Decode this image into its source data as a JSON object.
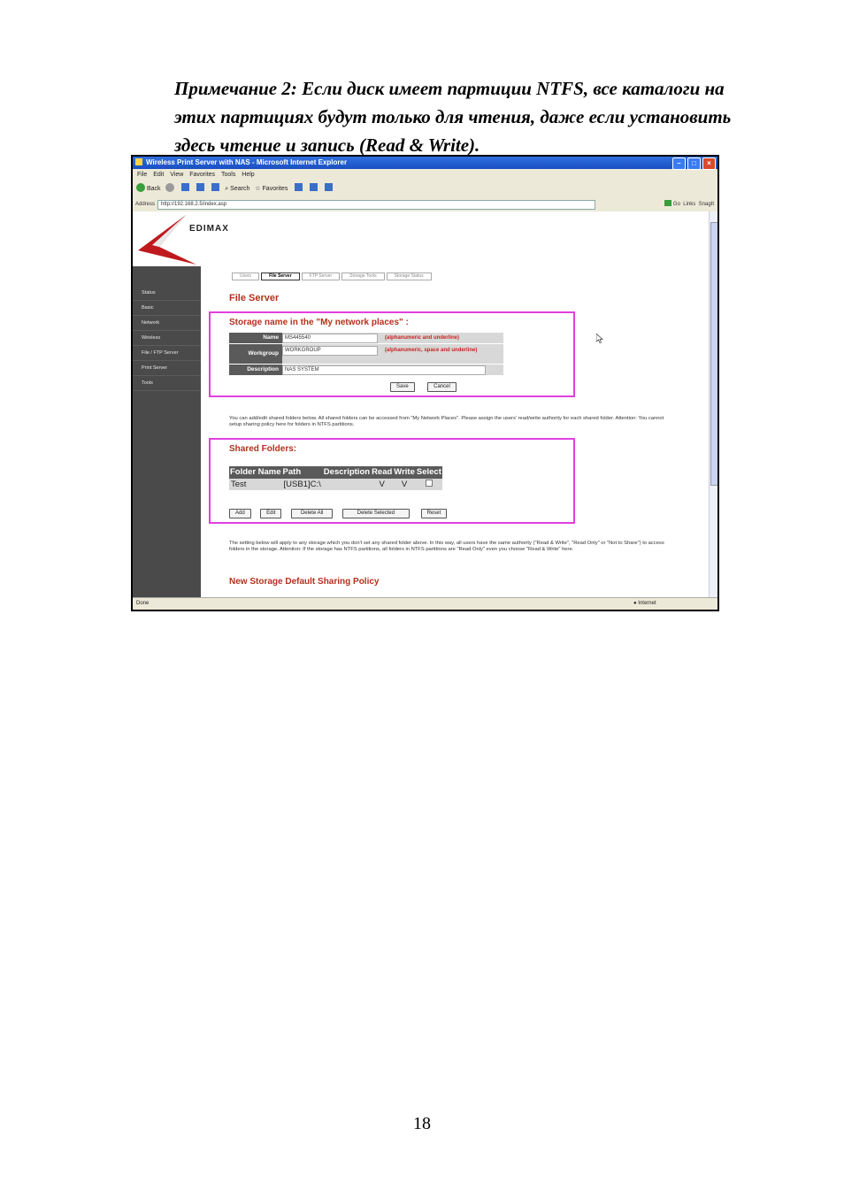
{
  "note": {
    "line1": "Примечание 2: Если диск имеет партиции NTFS, все каталоги на",
    "line2": "этих партициях будут только для чтения, даже если установить",
    "line3": "здесь чтение и запись (Read & Write)."
  },
  "page_number": "18",
  "browser": {
    "title": "Wireless Print Server with NAS - Microsoft Internet Explorer",
    "menu": [
      "File",
      "Edit",
      "View",
      "Favorites",
      "Tools",
      "Help"
    ],
    "toolbar": {
      "back": "Back",
      "search": "Search",
      "favorites": "Favorites"
    },
    "address_label": "Address",
    "address": "http://192.168.2.5/index.asp",
    "go": "Go",
    "links": "Links",
    "snagit": "SnagIt",
    "status_left": "Done",
    "status_right": "Internet"
  },
  "app": {
    "logo": "EDIMAX",
    "sidebar": [
      "Status",
      "Basic",
      "Network",
      "Wireless",
      "File / FTP Server",
      "Print Server",
      "Tools"
    ],
    "tabs": [
      "Users",
      "File Server",
      "FTP Server",
      "Storage Tools",
      "Storage Status"
    ],
    "active_tab": "File Server",
    "heading": "File Server",
    "storage_section": {
      "title": "Storage name in the \"My network places\" :",
      "name_label": "Name",
      "name_value": "MS445540",
      "name_hint": "(alphanumeric and underline)",
      "workgroup_label": "Workgroup",
      "workgroup_value": "WORKGROUP",
      "workgroup_hint": "(alphanumeric, space and underline)",
      "description_label": "Description",
      "description_value": "NAS SYSTEM",
      "save": "Save",
      "cancel": "Cancel"
    },
    "paragraph1": "You can add/edit shared folders below. All shared folders can be accessed from \"My Network Places\". Please assign the users' read/write authority for each shared folder. Attention: You cannot setup sharing policy here for folders in NTFS partitions.",
    "shared_section": {
      "title": "Shared Folders:",
      "columns": [
        "Folder Name",
        "Path",
        "Description",
        "Read",
        "Write",
        "Select"
      ],
      "rows": [
        {
          "folder": "Test",
          "path": "[USB1]C:\\",
          "description": "",
          "read": "V",
          "write": "V"
        }
      ],
      "buttons": {
        "add": "Add",
        "edit": "Edit",
        "delete_all": "Delete All",
        "delete_selected": "Delete Selected",
        "reset": "Reset"
      }
    },
    "paragraph2": "The setting below will apply to any storage which you don't set any shared folder above. In this way, all users have the same authority (\"Read & Write\", \"Read Only\" or \"Not to Share\") to access folders in the storage. Attention: If the storage has NTFS partitions, all folders in NTFS partitions are \"Read Only\" even you choose \"Read & Write\" here.",
    "policy_title": "New Storage Default Sharing Policy"
  },
  "colors": {
    "accent_red": "#b5301c",
    "highlight_box": "#e040e0",
    "sidebar_bg": "#4a4a4a"
  }
}
